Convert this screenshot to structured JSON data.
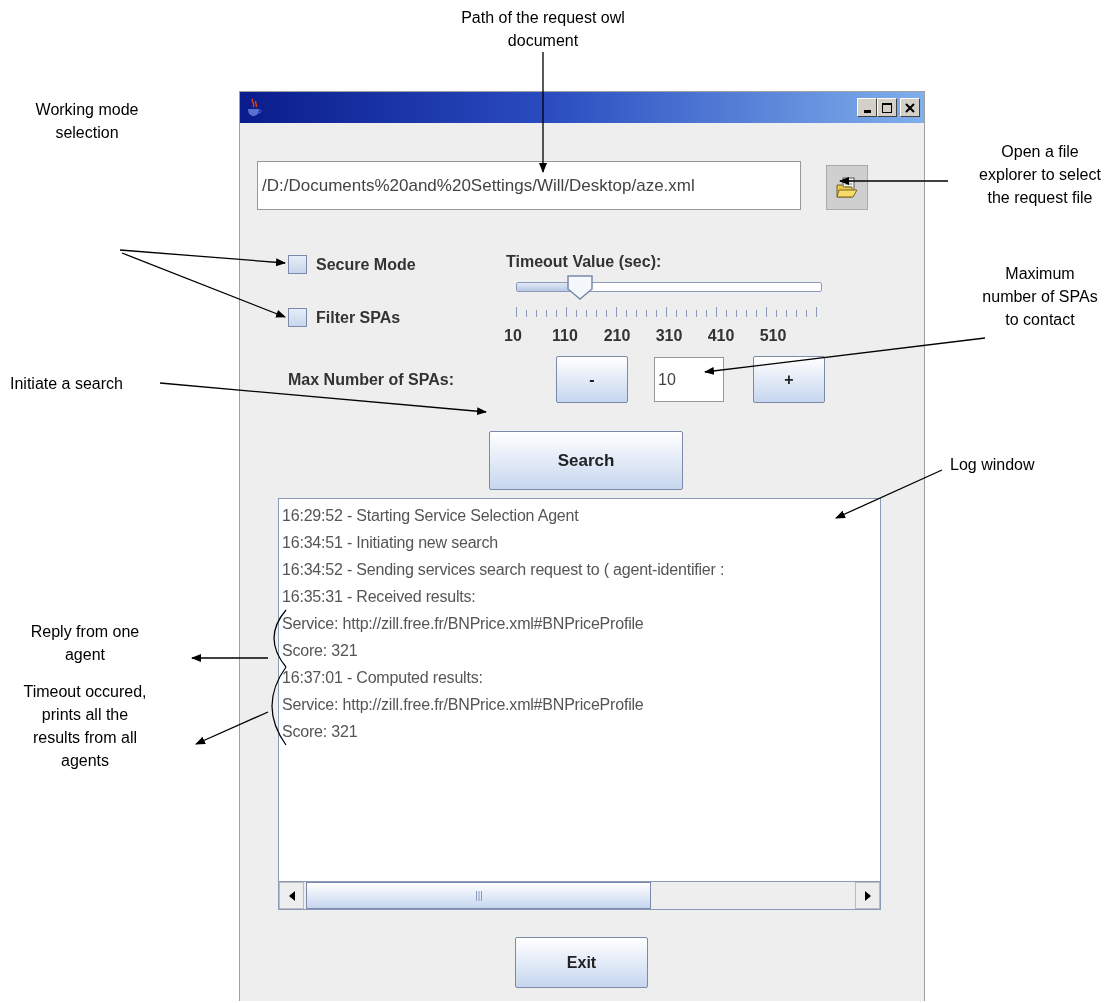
{
  "path_field": {
    "value": "/D:/Documents%20and%20Settings/Will/Desktop/aze.xml"
  },
  "checkboxes": [
    {
      "label": "Secure Mode",
      "checked": false
    },
    {
      "label": "Filter SPAs",
      "checked": false
    }
  ],
  "timeout_slider": {
    "label": "Timeout Value (sec):",
    "level": 0.21,
    "tick_labels": [
      "10",
      "110",
      "210",
      "310",
      "410",
      "510"
    ]
  },
  "max_spas": {
    "label": "Max Number of SPAs:",
    "decrement": "-",
    "value": "10",
    "increment": "+"
  },
  "search_button": "Search",
  "log": {
    "lines": [
      "16:29:52 - Starting Service Selection Agent",
      "16:34:51 - Initiating new search",
      "16:34:52 - Sending services search request to ( agent-identifier :",
      "16:35:31 - Received results:",
      "Service: http://zill.free.fr/BNPrice.xml#BNPriceProfile",
      "Score: 321",
      "16:37:01 - Computed results:",
      "Service: http://zill.free.fr/BNPrice.xml#BNPriceProfile",
      "Score: 321"
    ]
  },
  "exit_button": "Exit",
  "annotations": [
    {
      "lines": [
        "Path of the request owl",
        "document"
      ]
    },
    {
      "lines": [
        "Open a file",
        "explorer to select",
        "the request file"
      ]
    },
    {
      "lines": [
        "Working mode",
        "selection"
      ]
    },
    {
      "lines": [
        "Maximum",
        "number of SPAs",
        "to contact"
      ]
    },
    {
      "lines": [
        "Initiate a search"
      ]
    },
    {
      "lines": [
        "Log window"
      ]
    },
    {
      "lines": [
        "Reply from one",
        "agent"
      ]
    },
    {
      "lines": [
        "Timeout occured,",
        "prints all the",
        "results from all",
        "agents"
      ]
    }
  ]
}
